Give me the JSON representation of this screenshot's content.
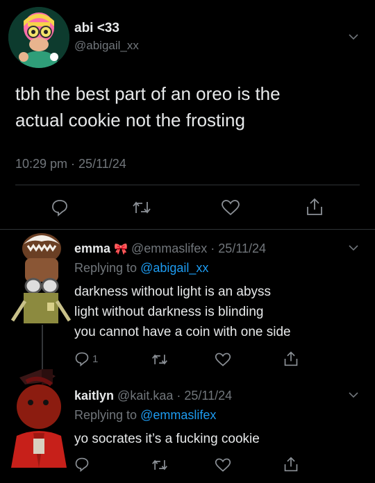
{
  "main_tweet": {
    "display_name": "abi <33",
    "handle": "@abigail_xx",
    "text_line1": "tbh the best part of an oreo is the",
    "text_line2": "actual cookie not the frosting",
    "timestamp": "10:29 pm · 25/11/24"
  },
  "replies": [
    {
      "display_name": "emma",
      "name_emoji": "🎀",
      "handle": "@emmaslifex",
      "date": "· 25/11/24",
      "replying_prefix": "Replying to",
      "replying_to": "@abigail_xx",
      "lines": [
        "darkness without light is an abyss",
        "light without darkness is blinding",
        "you cannot have a coin with one side"
      ],
      "reply_count": "1"
    },
    {
      "display_name": "kaitlyn",
      "handle": "@kait.kaa",
      "date": "· 25/11/24",
      "replying_prefix": "Replying to",
      "replying_to": "@emmaslifex",
      "lines": [
        "yo socrates it’s a fucking cookie"
      ]
    }
  ],
  "colors": {
    "background": "#000000",
    "text": "#e7e9ea",
    "muted": "#71767b",
    "link": "#1d9bf0",
    "divider": "#2f3336"
  },
  "icons": [
    "reply-icon",
    "retweet-icon",
    "like-icon",
    "share-icon",
    "chevron-down-icon"
  ]
}
